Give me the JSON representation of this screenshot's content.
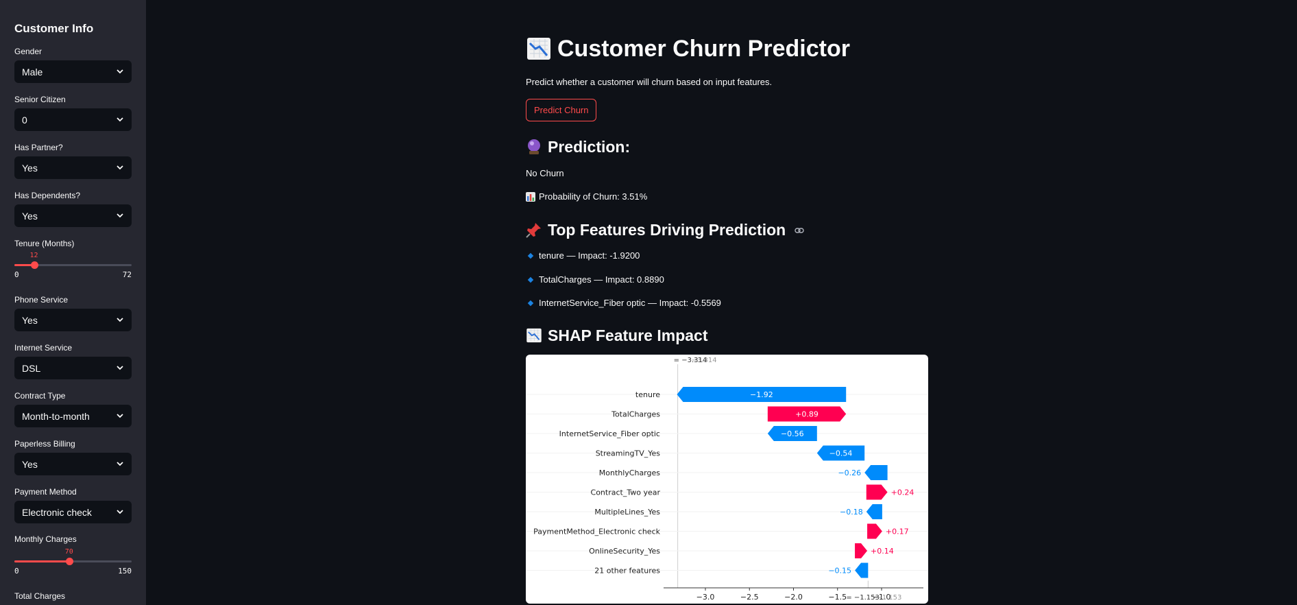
{
  "sidebar": {
    "title": "Customer Info",
    "gender": {
      "label": "Gender",
      "value": "Male"
    },
    "senior": {
      "label": "Senior Citizen",
      "value": "0"
    },
    "partner": {
      "label": "Has Partner?",
      "value": "Yes"
    },
    "dependents": {
      "label": "Has Dependents?",
      "value": "Yes"
    },
    "tenure": {
      "label": "Tenure (Months)",
      "value": 12,
      "value_text": "12",
      "min": 0,
      "min_text": "0",
      "max": 72,
      "max_text": "72"
    },
    "phone": {
      "label": "Phone Service",
      "value": "Yes"
    },
    "internet": {
      "label": "Internet Service",
      "value": "DSL"
    },
    "contract": {
      "label": "Contract Type",
      "value": "Month-to-month"
    },
    "paperless": {
      "label": "Paperless Billing",
      "value": "Yes"
    },
    "payment": {
      "label": "Payment Method",
      "value": "Electronic check"
    },
    "monthly": {
      "label": "Monthly Charges",
      "value": 70,
      "value_text": "70",
      "min": 0,
      "min_text": "0",
      "max": 150,
      "max_text": "150"
    },
    "total": {
      "label": "Total Charges"
    }
  },
  "main": {
    "title": "Customer Churn Predictor",
    "subtitle": "Predict whether a customer will churn based on input features.",
    "predict_button": "Predict Churn",
    "prediction_heading": "Prediction:",
    "prediction_result": "No Churn",
    "probability_text": "Probability of Churn: 3.51%",
    "top_features_heading": "Top Features Driving Prediction",
    "top_features": [
      "tenure — Impact: -1.9200",
      "TotalCharges — Impact: 0.8890",
      "InternetService_Fiber optic — Impact: -0.5569"
    ],
    "shap_heading": "SHAP Feature Impact"
  },
  "colors": {
    "accent": "#ff4b4b",
    "shap_positive": "#ff0051",
    "shap_negative": "#008bfb",
    "info_blue": "#1c83e1"
  },
  "icons": [
    "chart-decreasing-icon",
    "crystal-ball-icon",
    "bar-chart-icon",
    "pushpin-icon",
    "link-icon",
    "diamond-bullet-icon",
    "chevron-down-icon"
  ],
  "chart_data": {
    "type": "waterfall",
    "title": "",
    "xlabel": "",
    "ylabel": "",
    "features": [
      {
        "name": "tenure",
        "value": -1.92,
        "label": "−1.92"
      },
      {
        "name": "TotalCharges",
        "value": 0.89,
        "label": "+0.89"
      },
      {
        "name": "InternetService_Fiber optic",
        "value": -0.56,
        "label": "−0.56"
      },
      {
        "name": "StreamingTV_Yes",
        "value": -0.54,
        "label": "−0.54"
      },
      {
        "name": "MonthlyCharges",
        "value": -0.26,
        "label": "−0.26"
      },
      {
        "name": "Contract_Two year",
        "value": 0.24,
        "label": "+0.24"
      },
      {
        "name": "MultipleLines_Yes",
        "value": -0.18,
        "label": "−0.18"
      },
      {
        "name": "PaymentMethod_Electronic check",
        "value": 0.17,
        "label": "+0.17"
      },
      {
        "name": "OnlineSecurity_Yes",
        "value": 0.14,
        "label": "+0.14"
      },
      {
        "name": "21 other features",
        "value": -0.15,
        "label": "−0.15"
      }
    ],
    "base_value": -1.153,
    "base_label": "= −1.153",
    "base_label_ghost": "−1.153",
    "output_value": -3.314,
    "output_label": "= −3.314",
    "output_label_ghost": "−3.314",
    "xticks": [
      -3.0,
      -2.5,
      -2.0,
      -1.5,
      -1.0
    ],
    "xtick_labels": [
      "−3.0",
      "−2.5",
      "−2.0",
      "−1.5",
      "−1.0"
    ],
    "xlim": [
      -3.47,
      -0.52
    ],
    "grid": false
  }
}
